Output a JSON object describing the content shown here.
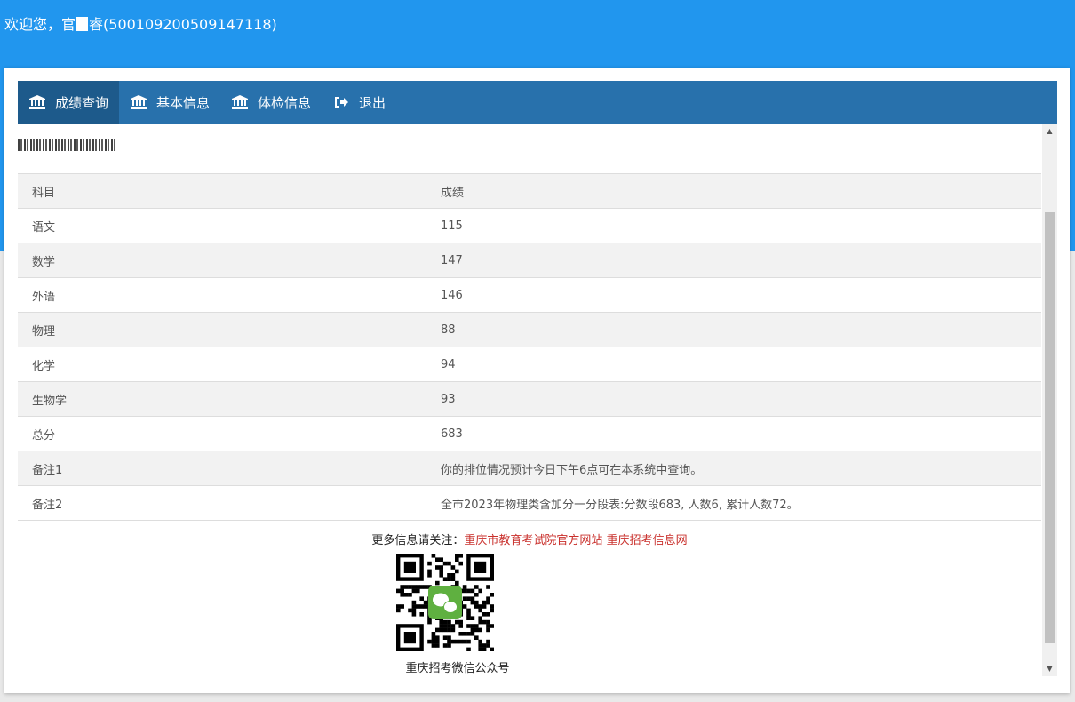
{
  "header": {
    "welcome_prefix": "欢迎您，官",
    "welcome_suffix": "睿(500109200509147118)"
  },
  "nav": {
    "items": [
      {
        "label": "成绩查询",
        "icon": "bank-icon",
        "active": true
      },
      {
        "label": "基本信息",
        "icon": "bank-icon",
        "active": false
      },
      {
        "label": "体检信息",
        "icon": "bank-icon",
        "active": false
      },
      {
        "label": "退出",
        "icon": "sign-out-icon",
        "active": false
      }
    ]
  },
  "table": {
    "headers": [
      "科目",
      "成绩"
    ],
    "rows": [
      [
        "语文",
        "115"
      ],
      [
        "数学",
        "147"
      ],
      [
        "外语",
        "146"
      ],
      [
        "物理",
        "88"
      ],
      [
        "化学",
        "94"
      ],
      [
        "生物学",
        "93"
      ],
      [
        "总分",
        "683"
      ],
      [
        "备注1",
        "你的排位情况预计今日下午6点可在本系统中查询。"
      ],
      [
        "备注2",
        "全市2023年物理类含加分一分段表:分数段683, 人数6, 累计人数72。"
      ]
    ]
  },
  "footer": {
    "follow_label": "更多信息请关注：",
    "link1": "重庆市教育考试院官方网站",
    "link2": "重庆招考信息网",
    "qr_caption": "重庆招考微信公众号"
  },
  "colors": {
    "top_band": "#2196ee",
    "navbar": "#2871ac",
    "nav_active": "#1d5a8b",
    "link": "#c9302c",
    "wechat_green": "#5fb040"
  }
}
